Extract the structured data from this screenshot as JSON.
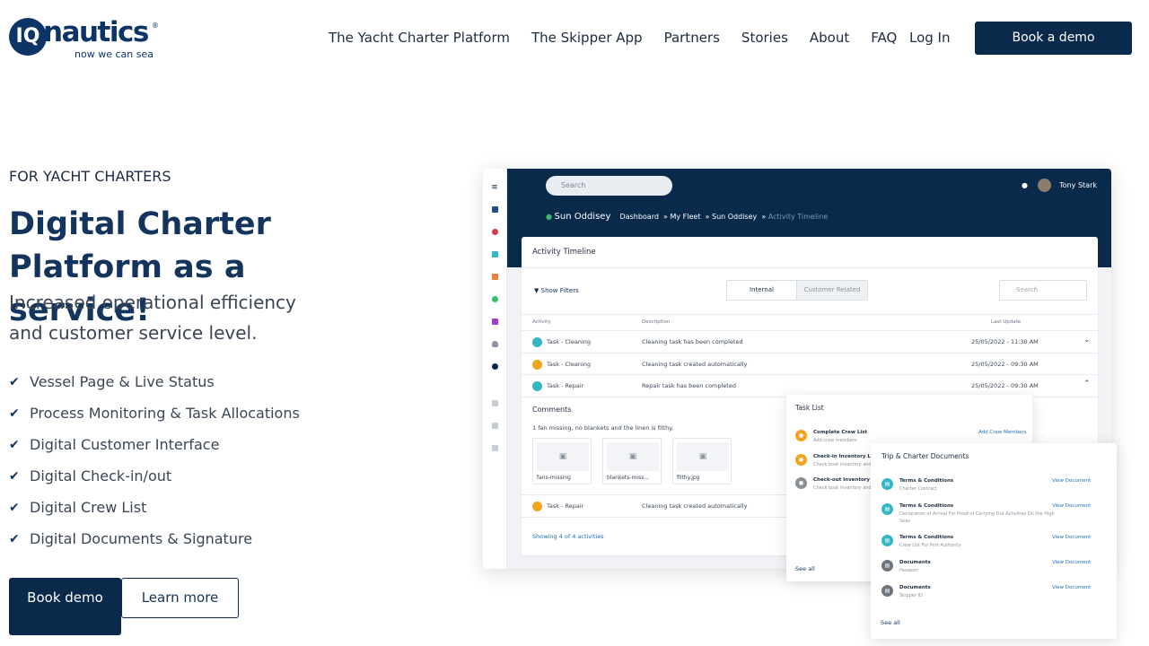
{
  "brand": {
    "word": "nautics",
    "mark": "IQ",
    "registered": "®",
    "tagline": "now we can sea"
  },
  "nav": {
    "items": [
      "The Yacht Charter Platform",
      "The Skipper App",
      "Partners",
      "Stories",
      "About",
      "FAQ"
    ],
    "login": "Log In",
    "demo": "Book a demo"
  },
  "hero": {
    "eyebrow": "FOR YACHT CHARTERS",
    "title_line1": "Digital Charter",
    "title_line2": "Platform as a service!",
    "subtitle": "Increased operational efficiency and customer service level.",
    "features": [
      "Vessel Page & Live Status",
      "Process Monitoring & Task Allocations",
      "Digital Customer Interface",
      "Digital Check-in/out",
      "Digital Crew List",
      "Digital Documents & Signature"
    ],
    "cta_primary": "Book demo",
    "cta_secondary": "Learn more"
  },
  "mock": {
    "search": "Search",
    "user": "Tony Stark",
    "vessel": "Sun Oddisey",
    "breadcrumb": [
      "Dashboard",
      "My Fleet",
      "Sun Oddisey",
      "Activity Timeline"
    ],
    "card_title": "Activity Timeline",
    "show_filters": "Show Filters",
    "segments": [
      "Internal",
      "Customer Related"
    ],
    "search2": "Search",
    "columns": [
      "Activity",
      "Description",
      "Last Update"
    ],
    "rows": [
      {
        "activity": "Task - Cleaning",
        "desc": "Cleaning task has been completed",
        "date": "25/05/2022 - 11:30 AM",
        "color": "#34b7c4"
      },
      {
        "activity": "Task - Cleaning",
        "desc": "Cleaning task created automatically",
        "date": "25/05/2022 - 09:30 AM",
        "color": "#f2a41f"
      },
      {
        "activity": "Task - Repair",
        "desc": "Repair task has been completed",
        "date": "25/05/2022 - 09:30 AM",
        "color": "#34b7c4"
      },
      {
        "activity": "Task - Repair",
        "desc": "Cleaning task created automatically",
        "date": "",
        "color": "#f2a41f"
      }
    ],
    "comments_title": "Comments",
    "comment": "1 fan missing, no blankets and the linen is filthy.",
    "attachments": [
      "fans-missing",
      "blankets-miss...",
      "filthy.jpg"
    ],
    "showing": "Showing 4 of 4 activities"
  },
  "task_panel": {
    "title": "Task List",
    "items": [
      {
        "name": "Complete Crew List",
        "sub": "Add crew members",
        "link": "Add Crew Members",
        "color": "#f2a41f"
      },
      {
        "name": "Check-in Inventory List",
        "sub": "Check boat inventory and c",
        "link": "",
        "color": "#f2a41f"
      },
      {
        "name": "Check-out Inventory List",
        "sub": "Check boat inventory and c",
        "link": "",
        "color": "#8a8f96"
      }
    ],
    "see_all": "See all"
  },
  "docs_panel": {
    "title": "Trip & Charter Documents",
    "items": [
      {
        "name": "Terms & Conditions",
        "sub": "Charter Contract",
        "link": "View Document",
        "color": "#34b7c4"
      },
      {
        "name": "Terms & Conditions",
        "sub": "Declaration of Arrival For Proof of Carrying Out Activities On the High Seas",
        "link": "View Document",
        "color": "#34b7c4"
      },
      {
        "name": "Terms & Conditions",
        "sub": "Crew List For Port Authority",
        "link": "View Document",
        "color": "#34b7c4"
      },
      {
        "name": "Documents",
        "sub": "Passport",
        "link": "View Document",
        "color": "#6f757c"
      },
      {
        "name": "Documents",
        "sub": "Skipper ID",
        "link": "View Document",
        "color": "#6f757c"
      }
    ],
    "see_all": "See all"
  }
}
